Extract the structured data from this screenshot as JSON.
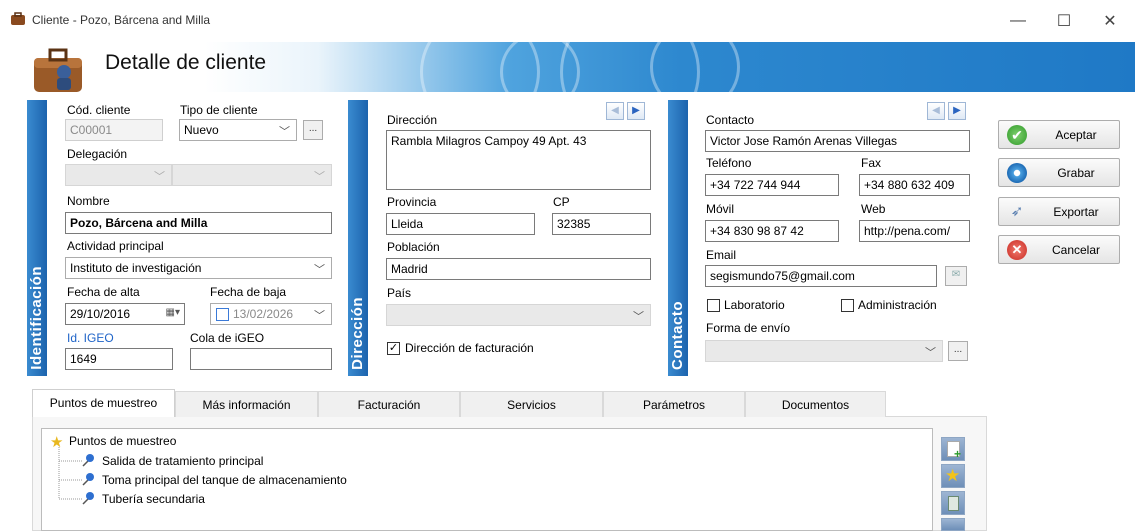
{
  "window": {
    "title": "Cliente - Pozo, Bárcena and Milla",
    "controls": {
      "minimize": "—",
      "maximize": "☐",
      "close": "✕"
    }
  },
  "header": {
    "title": "Detalle de cliente"
  },
  "sections": {
    "identificacion": "Identificación",
    "direccion": "Dirección",
    "contacto": "Contacto"
  },
  "identificacion": {
    "cod_cliente_label": "Cód. cliente",
    "cod_cliente_value": "C00001",
    "tipo_cliente_label": "Tipo de cliente",
    "tipo_cliente_value": "Nuevo",
    "delegacion_label": "Delegación",
    "nombre_label": "Nombre",
    "nombre_value": "Pozo, Bárcena and Milla",
    "actividad_label": "Actividad principal",
    "actividad_value": "Instituto de investigación",
    "fecha_alta_label": "Fecha de alta",
    "fecha_alta_value": "29/10/2016",
    "fecha_baja_label": "Fecha de baja",
    "fecha_baja_value": "13/02/2026",
    "id_igeo_label": "Id. IGEO",
    "id_igeo_value": "1649",
    "cola_igeo_label": "Cola de iGEO",
    "cola_igeo_value": ""
  },
  "direccion": {
    "direccion_label": "Dirección",
    "direccion_value": "Rambla Milagros Campoy 49 Apt. 43",
    "provincia_label": "Provincia",
    "provincia_value": "Lleida",
    "cp_label": "CP",
    "cp_value": "32385",
    "poblacion_label": "Población",
    "poblacion_value": "Madrid",
    "pais_label": "País",
    "pais_value": "",
    "facturacion_label": "Dirección de facturación",
    "facturacion_checked": true
  },
  "contacto": {
    "contacto_label": "Contacto",
    "contacto_value": "Victor Jose Ramón Arenas Villegas",
    "telefono_label": "Teléfono",
    "telefono_value": "+34 722 744 944",
    "fax_label": "Fax",
    "fax_value": "+34 880 632 409",
    "movil_label": "Móvil",
    "movil_value": "+34 830 98 87 42",
    "web_label": "Web",
    "web_value": "http://pena.com/",
    "email_label": "Email",
    "email_value": "segismundo75@gmail.com",
    "laboratorio_label": "Laboratorio",
    "administracion_label": "Administración",
    "forma_envio_label": "Forma de envío"
  },
  "actions": {
    "aceptar": "Aceptar",
    "grabar": "Grabar",
    "exportar": "Exportar",
    "cancelar": "Cancelar"
  },
  "tabs": [
    "Puntos de muestreo",
    "Más información",
    "Facturación",
    "Servicios",
    "Parámetros",
    "Documentos"
  ],
  "tree": {
    "root": "Puntos de muestreo",
    "items": [
      "Salida de tratamiento principal",
      "Toma principal del tanque de almacenamiento",
      "Tubería secundaria"
    ]
  },
  "colors": {
    "accent_blue": "#1c63ad",
    "aceptar_green": "#3fae3a",
    "cancelar_red": "#d9342b"
  }
}
